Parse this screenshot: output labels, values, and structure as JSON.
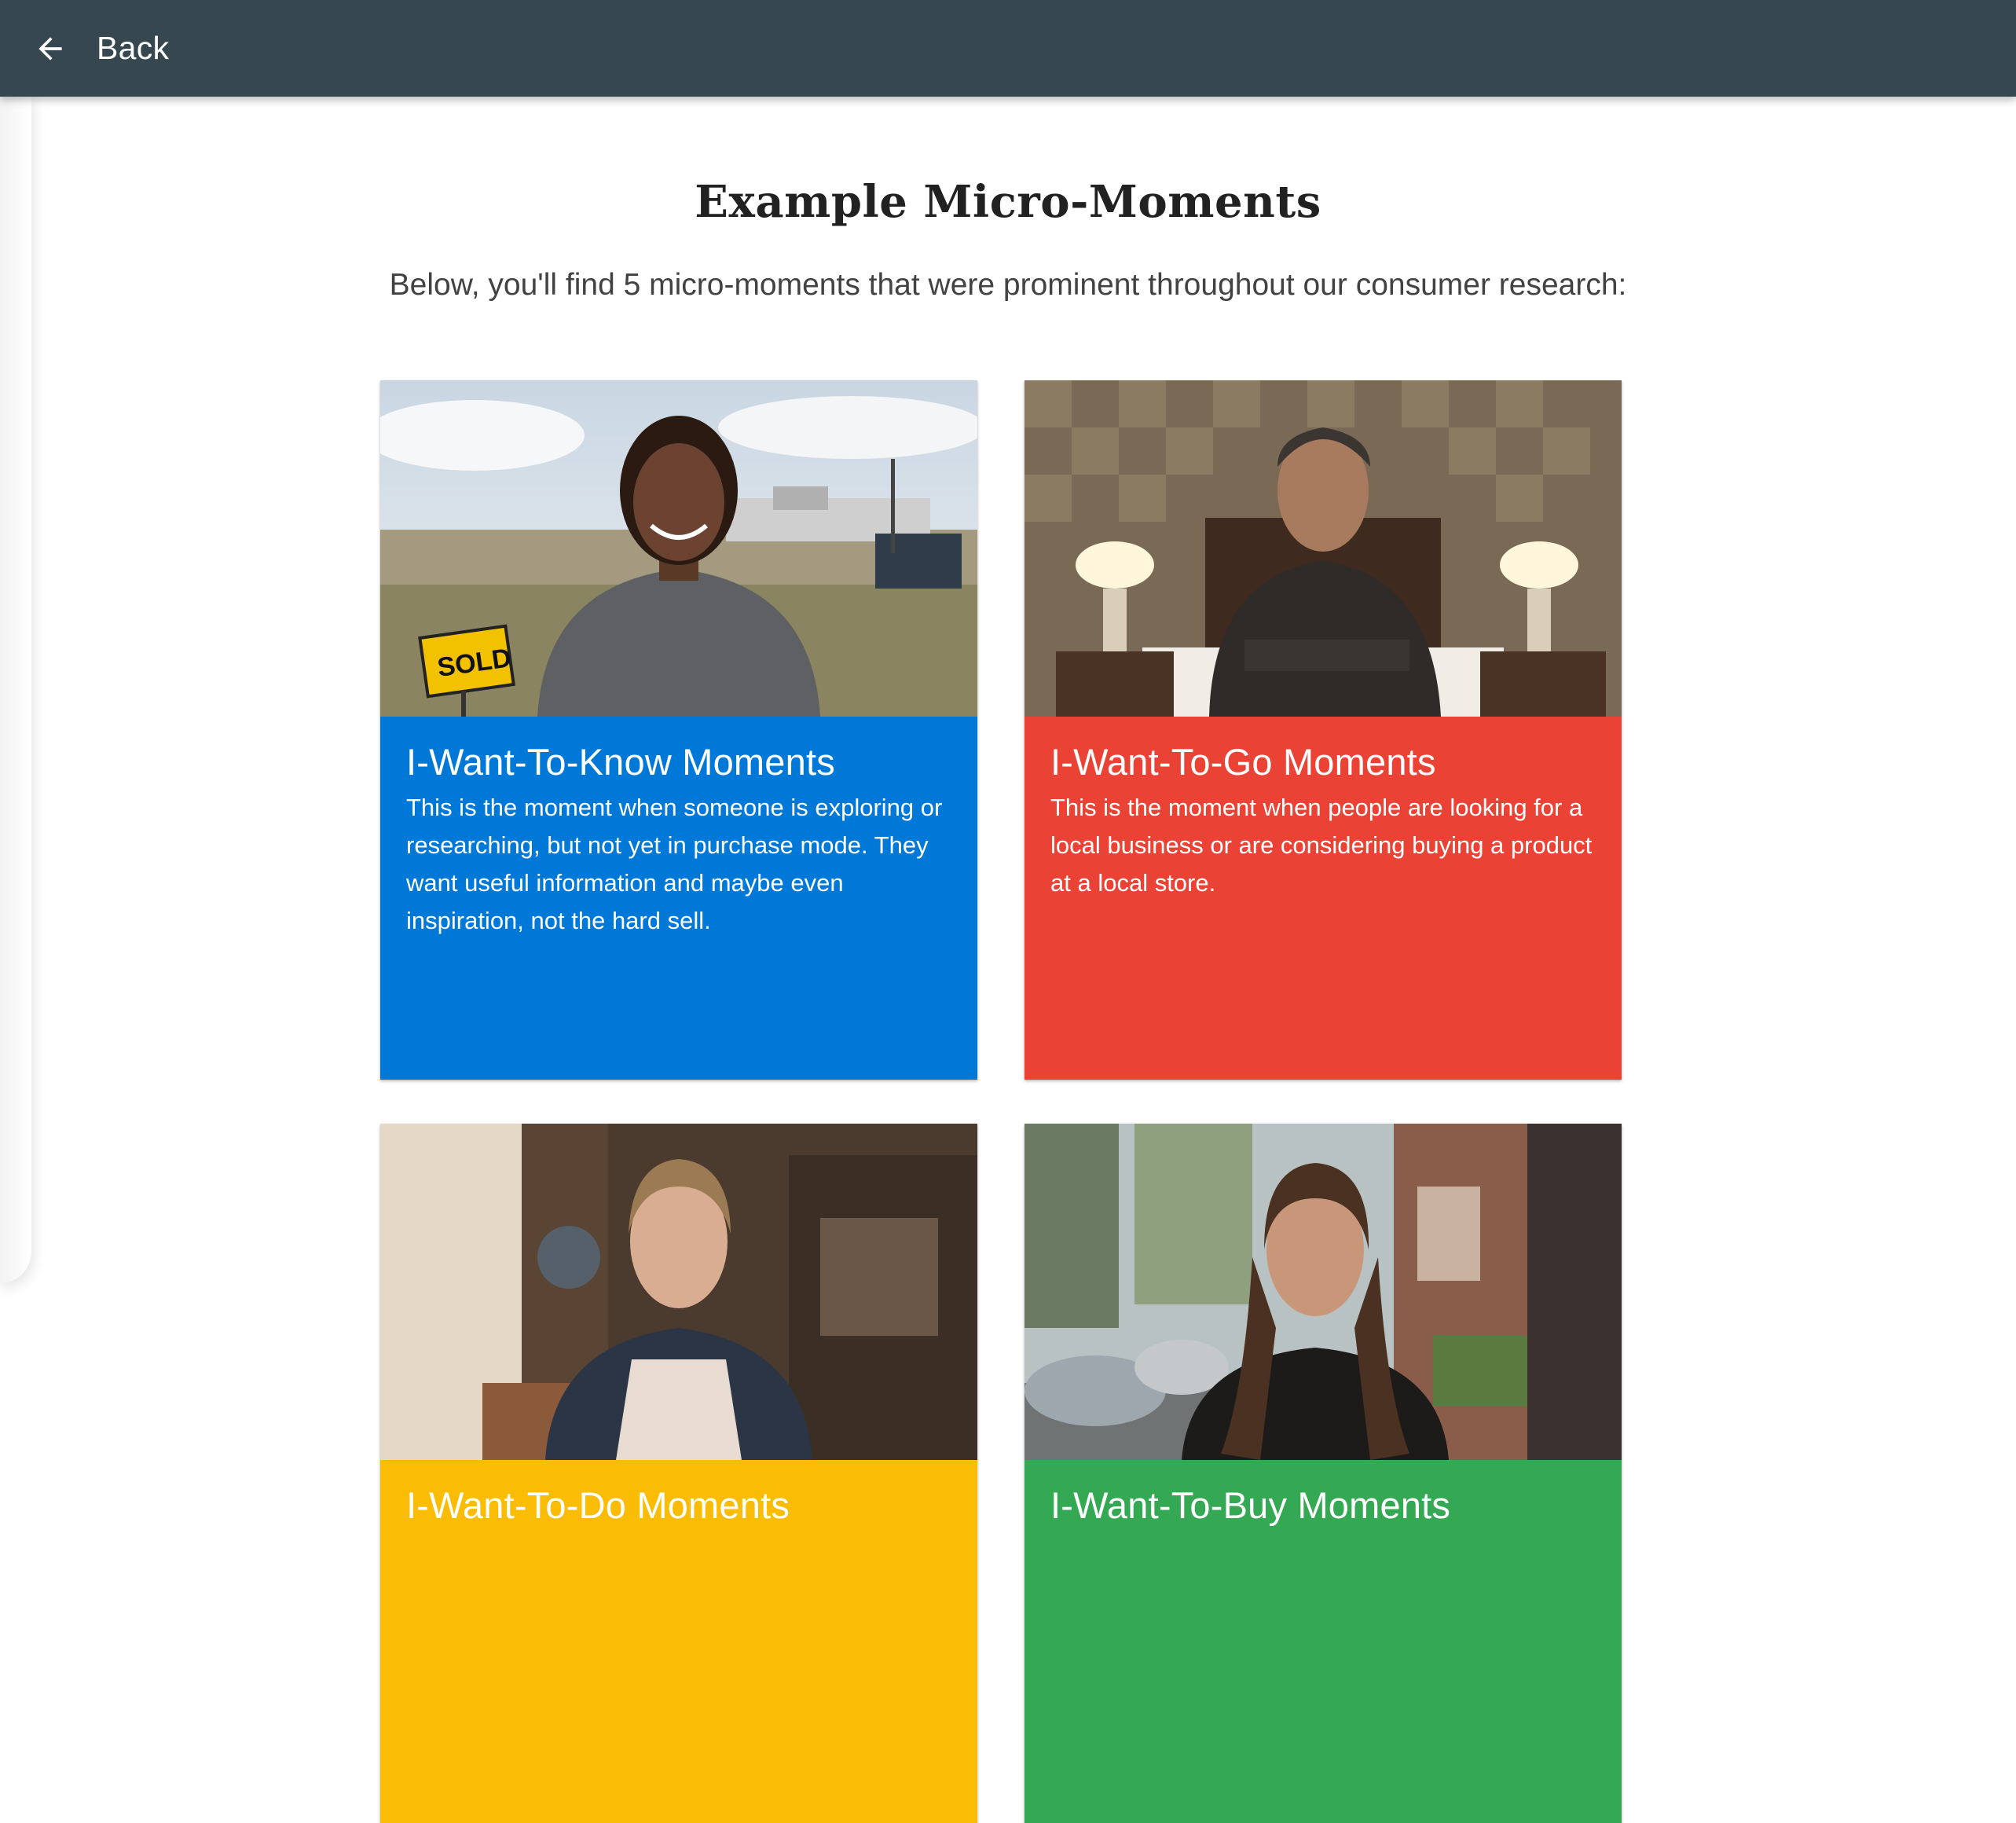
{
  "topbar": {
    "back_label": "Back",
    "back_icon": "arrow-left-icon"
  },
  "header": {
    "title": "Example Micro-Moments",
    "subtitle": "Below, you'll find 5 micro-moments that were prominent throughout our consumer research:"
  },
  "cards": [
    {
      "title": "I-Want-To-Know Moments",
      "text": "This is the moment when someone is exploring or researching, but not yet in purchase mode. They want useful information and maybe even inspiration, not the hard sell.",
      "color": "#0078d7",
      "sign_text": "SOLD"
    },
    {
      "title": "I-Want-To-Go Moments",
      "text": "This is the moment when people are looking for a local business or are considering buying a product at a local store.",
      "color": "#ea4335"
    },
    {
      "title": "I-Want-To-Do Moments",
      "text": "",
      "color": "#fbbc05"
    },
    {
      "title": "I-Want-To-Buy Moments",
      "text": "",
      "color": "#34a853"
    }
  ]
}
